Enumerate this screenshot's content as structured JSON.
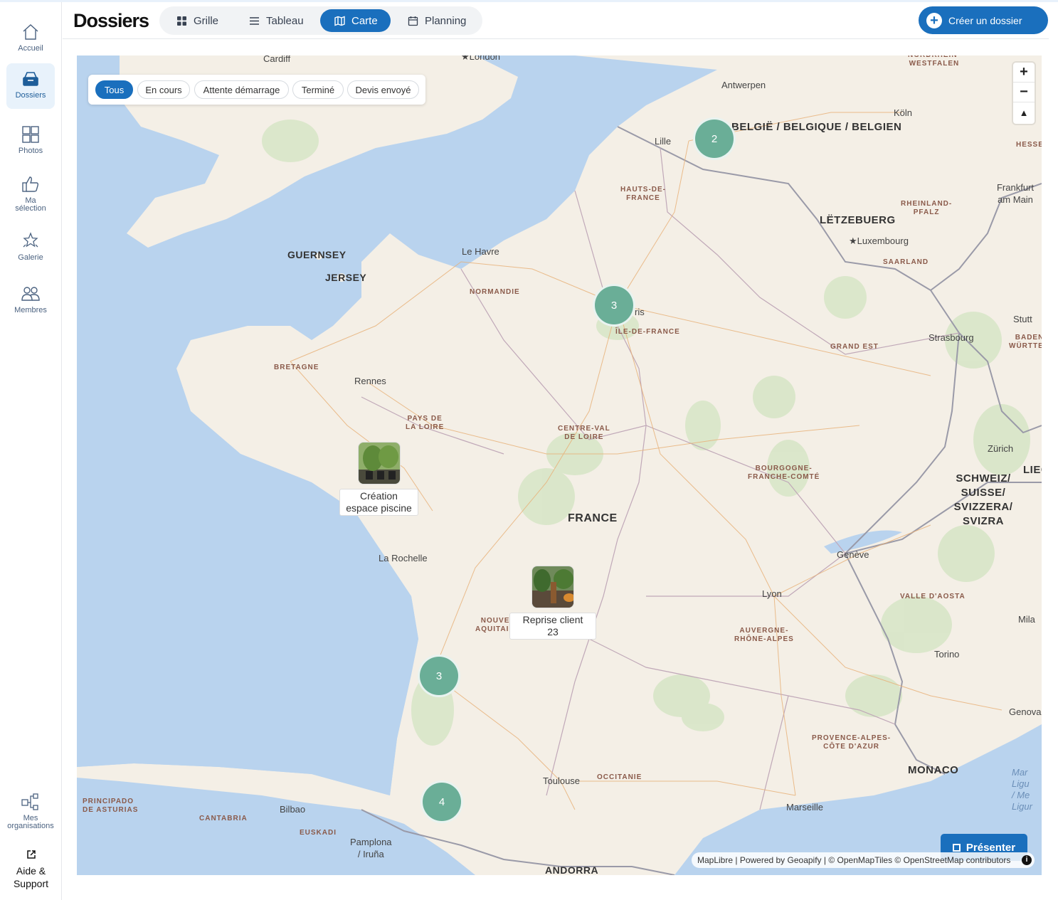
{
  "sidebar": {
    "items": [
      {
        "label": "Accueil",
        "icon": "home-icon"
      },
      {
        "label": "Dossiers",
        "icon": "folder-inbox-icon",
        "active": true
      },
      {
        "label": "Photos",
        "icon": "grid-icon"
      },
      {
        "label": "Ma sélection",
        "icon": "thumbs-up-icon"
      },
      {
        "label": "Galerie",
        "icon": "stars-icon"
      },
      {
        "label": "Membres",
        "icon": "users-icon"
      },
      {
        "label": "Mes organisations",
        "icon": "organization-icon"
      }
    ],
    "help_label": "Aide & Support"
  },
  "header": {
    "title": "Dossiers",
    "tabs": [
      {
        "label": "Grille",
        "icon": "grid-icon"
      },
      {
        "label": "Tableau",
        "icon": "list-icon"
      },
      {
        "label": "Carte",
        "icon": "map-icon",
        "active": true
      },
      {
        "label": "Planning",
        "icon": "calendar-icon"
      }
    ],
    "create_label": "Créer un dossier"
  },
  "map": {
    "filters": [
      {
        "label": "Tous",
        "active": true
      },
      {
        "label": "En cours"
      },
      {
        "label": "Attente démarrage"
      },
      {
        "label": "Terminé"
      },
      {
        "label": "Devis envoyé"
      }
    ],
    "clusters": [
      {
        "count": "2"
      },
      {
        "count": "3"
      },
      {
        "count": "3"
      },
      {
        "count": "4"
      }
    ],
    "pins": [
      {
        "label": "Création espace piscine"
      },
      {
        "label": "Reprise client 23"
      }
    ],
    "zoom_in": "+",
    "zoom_out": "−",
    "compass": "▲",
    "present_label": "Présenter",
    "attribution": "MapLibre | Powered by Geoapify | © OpenMapTiles © OpenStreetMap contributors",
    "labels": {
      "cardiff": "Cardiff",
      "london": "★London",
      "antwerpen": "Antwerpen",
      "koln": "Köln",
      "nrw": "NORDRHEIN-\nWESTFALEN",
      "lille": "Lille",
      "belgique": "BELGIË / BELGIQUE / BELGIEN",
      "hesse": "HESSE",
      "frankfurt": "Frankfurt am Main",
      "hauts": "HAUTS-DE-\nFRANCE",
      "rheinland": "RHEINLAND-\nPFALZ",
      "letzebuerg": "LËTZEBUERG",
      "luxembourg": "★Luxembourg",
      "saarland": "SAARLAND",
      "guernsey": "GUERNSEY",
      "jersey": "JERSEY",
      "lehavre": "Le Havre",
      "normandie": "NORMANDIE",
      "paris": "ris",
      "idf": "ÎLE-DE-FRANCE",
      "stutt": "Stutt",
      "baden": "BADEN\nWÜRTTEM",
      "strasbourg": "Strasbourg",
      "grandest": "GRAND EST",
      "bretagne": "BRETAGNE",
      "rennes": "Rennes",
      "paysdeloire": "PAYS DE\nLA LOIRE",
      "centre": "CENTRE-VAL\nDE LOIRE",
      "bourgogne": "BOURGOGNE-\nFRANCHE-COMTÉ",
      "zurich": "Zürich",
      "liec": "LIEC",
      "schweiz": "SCHWEIZ/ SUISSE/ SVIZZERA/ SVIZRA",
      "france": "FRANCE",
      "larochelle": "La Rochelle",
      "geneve": "Genève",
      "lyon": "Lyon",
      "valle": "VALLE D'AOSTA",
      "nouvelle": "NOUVEL\nAQUITAINE",
      "mila": "Mila",
      "auvergne": "AUVERGNE-\nRHÔNE-ALPES",
      "torino": "Torino",
      "genova": "Genova",
      "paca": "PROVENCE-ALPES-\nCÔTE D'AZUR",
      "monaco": "MONACO",
      "mar": "Mar\nLigu\n/ Me\nLigur",
      "toulouse": "Toulouse",
      "occitanie": "OCCITANIE",
      "principado": "PRINCIPADO\nDE ASTURIAS",
      "bilbao": "Bilbao",
      "cantabria": "CANTABRIA",
      "euskadi": "EUSKADI",
      "marseille": "Marseille",
      "pamplona": "Pamplona\n/ Iruña",
      "andorra": "ANDORRA"
    }
  },
  "colors": {
    "accent": "#1a6fbd",
    "cluster": "#6aae97",
    "sea": "#b9d3ee",
    "land": "#f4efe6"
  }
}
